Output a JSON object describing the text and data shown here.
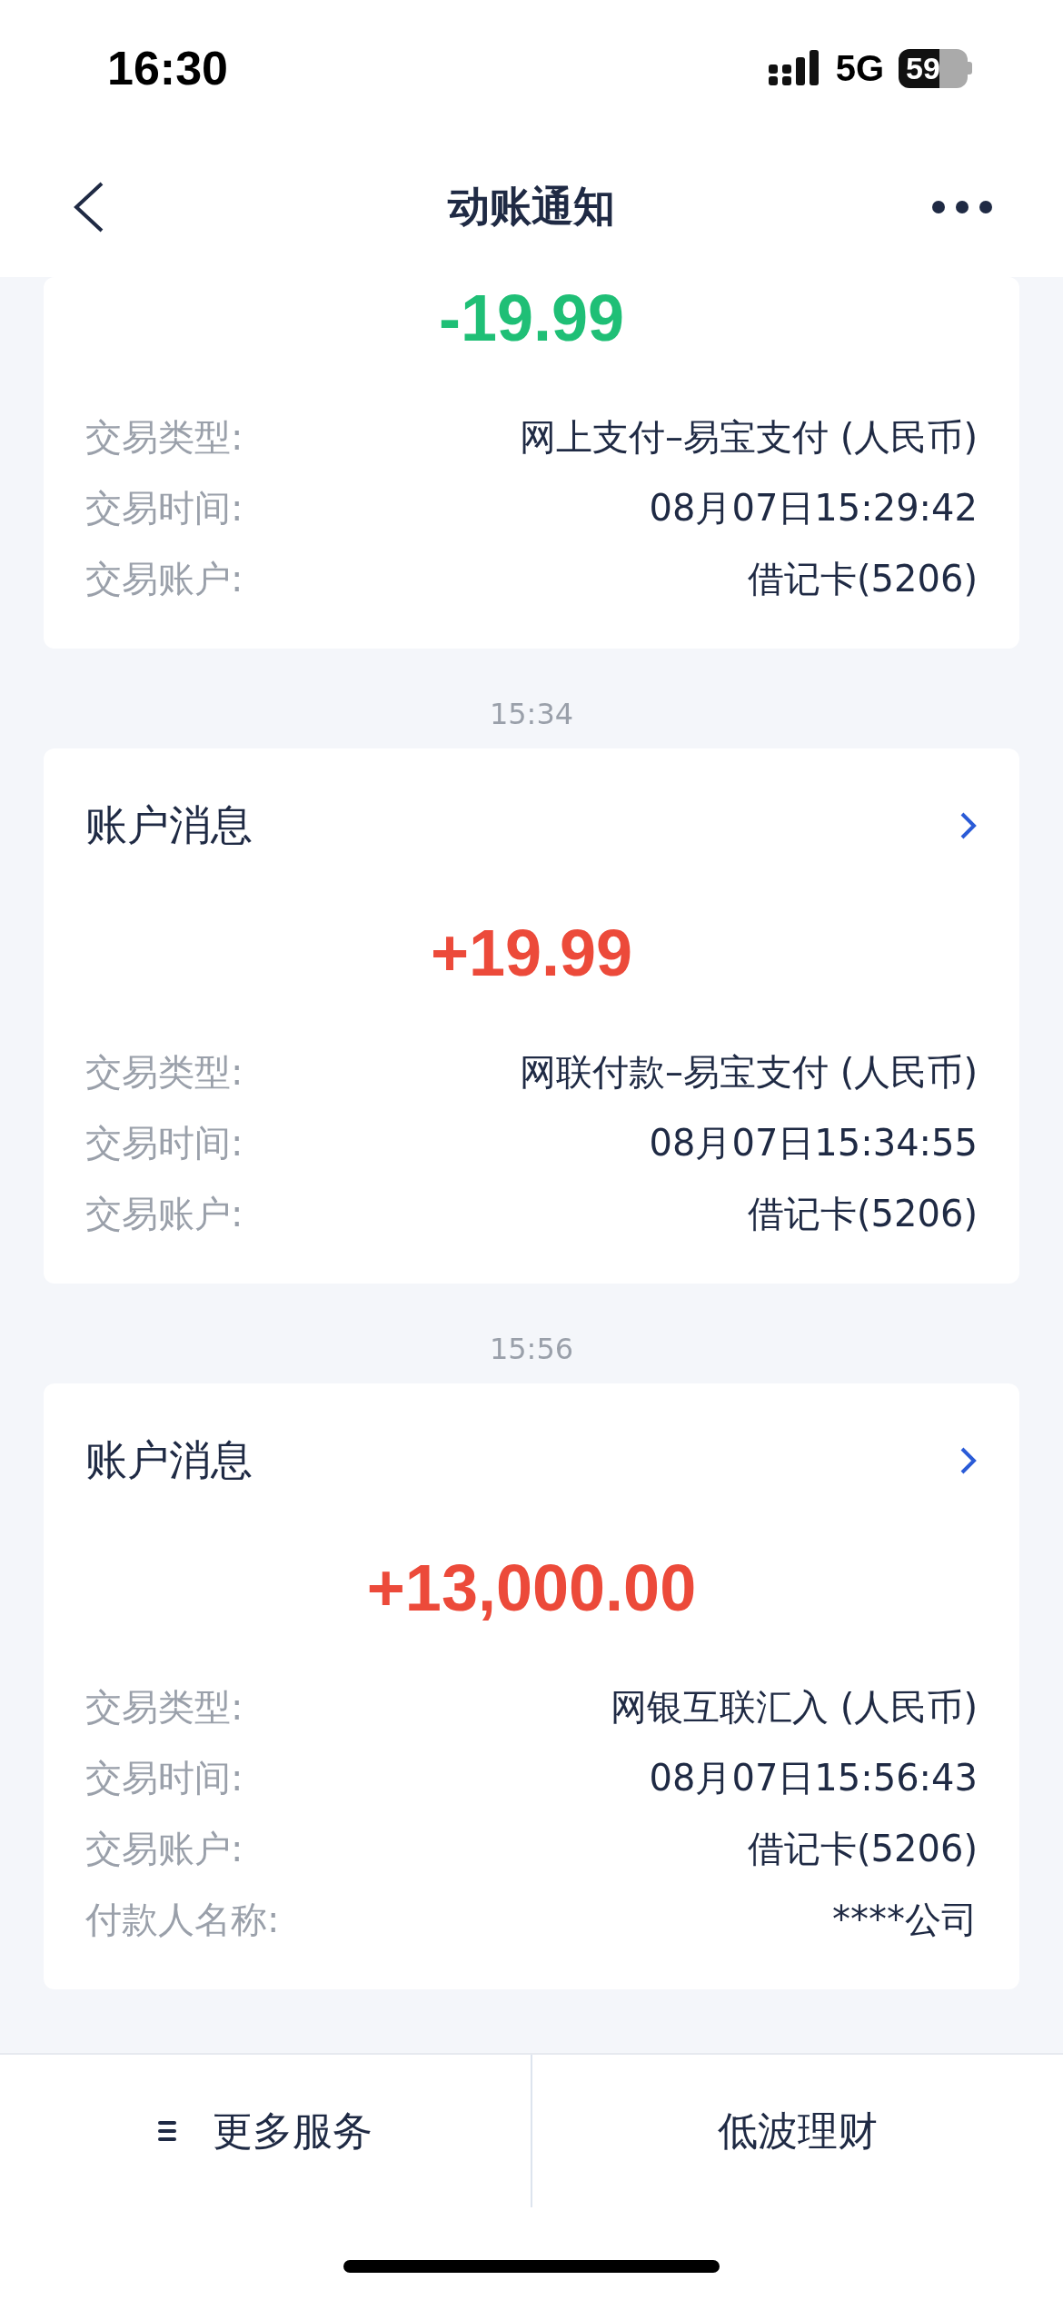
{
  "status_bar": {
    "time": "16:30",
    "network": "5G",
    "battery": "59"
  },
  "nav": {
    "title": "动账通知"
  },
  "notifications": [
    {
      "kind": "expense",
      "amount": "-19.99",
      "rows": [
        {
          "label": "交易类型:",
          "value": "网上支付–易宝支付 (人民币)"
        },
        {
          "label": "交易时间:",
          "value": "08月07日15:29:42"
        },
        {
          "label": "交易账户:",
          "value": "借记卡(5206)"
        }
      ]
    },
    {
      "time": "15:34",
      "title": "账户消息",
      "kind": "income",
      "amount": "+19.99",
      "rows": [
        {
          "label": "交易类型:",
          "value": "网联付款–易宝支付 (人民币)"
        },
        {
          "label": "交易时间:",
          "value": "08月07日15:34:55"
        },
        {
          "label": "交易账户:",
          "value": "借记卡(5206)"
        }
      ]
    },
    {
      "time": "15:56",
      "title": "账户消息",
      "kind": "income",
      "amount": "+13,000.00",
      "rows": [
        {
          "label": "交易类型:",
          "value": "网银互联汇入 (人民币)"
        },
        {
          "label": "交易时间:",
          "value": "08月07日15:56:43"
        },
        {
          "label": "交易账户:",
          "value": "借记卡(5206)"
        },
        {
          "label": "付款人名称:",
          "value": "****公司"
        }
      ]
    }
  ],
  "bottom_bar": [
    {
      "kind": "menu",
      "label": "更多服务"
    },
    {
      "kind": "plain",
      "label": "低波理财"
    }
  ]
}
